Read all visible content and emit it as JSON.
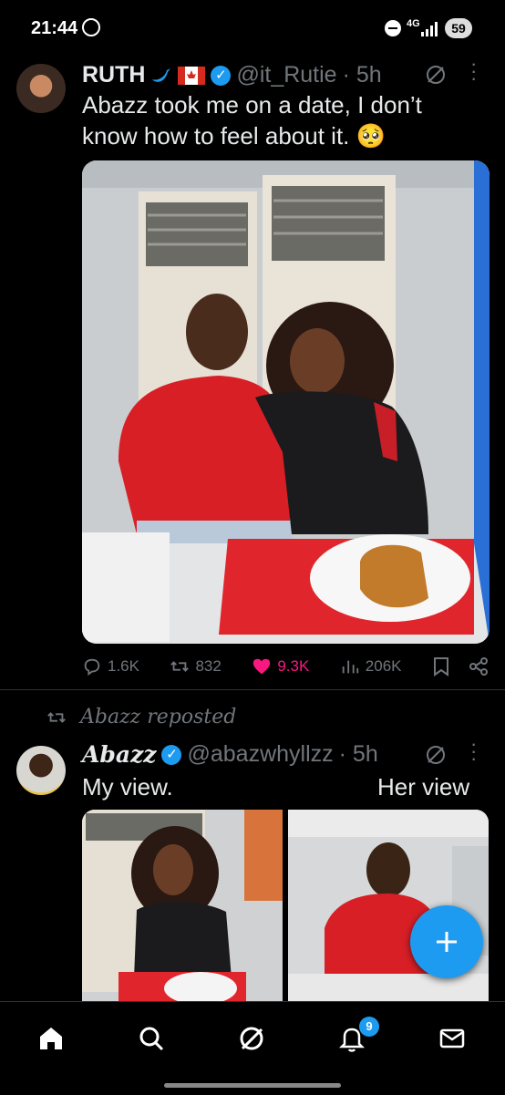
{
  "status_bar": {
    "time": "21:44",
    "network": "4G",
    "battery": "59"
  },
  "tweets": [
    {
      "name": "RUTH",
      "flag_icons": [
        "twitter-bird-icon",
        "canada-flag-icon"
      ],
      "handle": "@it_Rutie",
      "time": "· 5h",
      "text": "Abazz took me on a date, I don’t know how to feel about it. 🥺",
      "replies": "1.6K",
      "retweets": "832",
      "likes": "9.3K",
      "views": "206K",
      "liked": true
    },
    {
      "repost_label": "Abazz reposted",
      "name": "Abazz",
      "handle": "@abazwhyllzz",
      "time": "· 5h",
      "caption_left": "My view.",
      "caption_right": "Her view"
    }
  ],
  "bottom_nav": {
    "items": [
      "home-icon",
      "search-icon",
      "grok-icon",
      "notifications-icon",
      "messages-icon"
    ],
    "notification_count": "9"
  },
  "colors": {
    "accent": "#1d9bf0",
    "like": "#f91880",
    "muted": "#71767b"
  }
}
